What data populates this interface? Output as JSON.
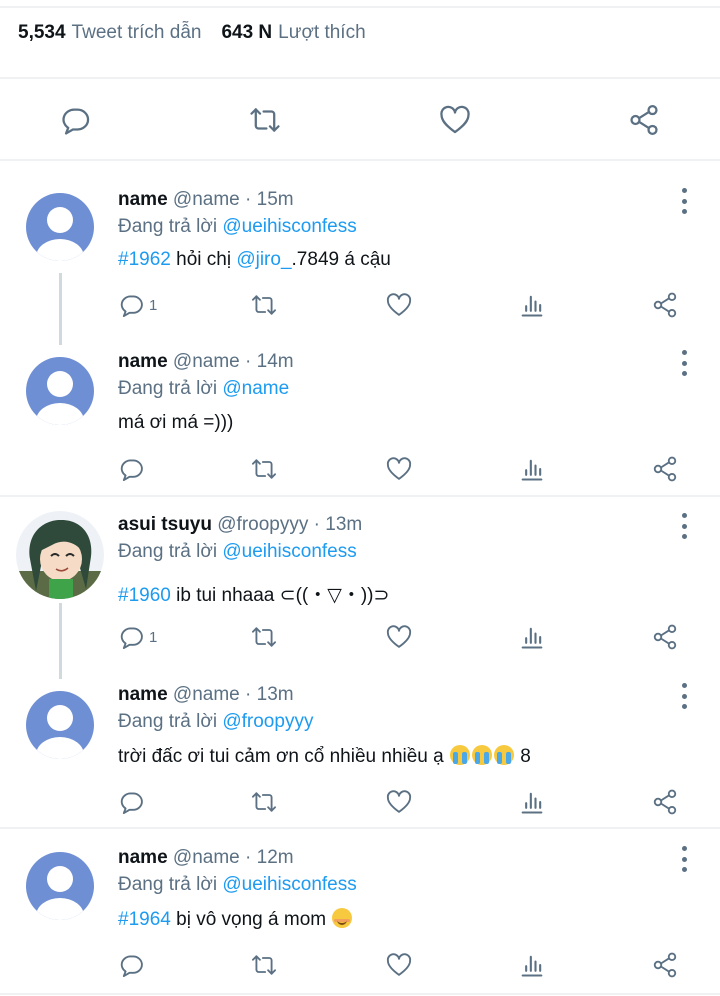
{
  "stats": {
    "quote_count": "5,534",
    "quote_label": "Tweet trích dẫn",
    "like_count": "643 N",
    "like_label": "Lượt thích"
  },
  "colors": {
    "link": "#1d9bf0",
    "secondary_text": "#5b7083",
    "primary_text": "#0f1419",
    "divider": "#eff1f3"
  },
  "replying_prefix": "Đang trả lời",
  "tweets": [
    {
      "name": "name",
      "handle": "@name",
      "time": "· 15m",
      "replying_to": "@ueihisconfess",
      "text_parts": {
        "tag": "#1962",
        "t1": " hỏi chị ",
        "mention": "@jiro_",
        "t2": ".7849 á cậu"
      },
      "reply_count": "1",
      "avatar_icon": "default-avatar-icon"
    },
    {
      "name": "name",
      "handle": "@name",
      "time": "· 14m",
      "replying_to": "@name",
      "text": "má ơi má =)))",
      "reply_count": "",
      "avatar_icon": "default-avatar-icon"
    },
    {
      "name": "asui tsuyu",
      "handle": "@froopyyy",
      "time": "· 13m",
      "replying_to": "@ueihisconfess",
      "text_parts": {
        "tag": "#1960",
        "t1": " ib tui nhaaa ⊂((・▽・))⊃"
      },
      "reply_count": "1",
      "avatar_icon": "anime-avatar-icon"
    },
    {
      "name": "name",
      "handle": "@name",
      "time": "· 13m",
      "replying_to": "@froopyyy",
      "text_parts": {
        "t1": "trời đấc ơi tui cảm ơn cổ nhiều nhiều ạ ",
        "t2": " 8"
      },
      "reply_count": "",
      "avatar_icon": "default-avatar-icon",
      "emoji": "loudly-crying-face-icon"
    },
    {
      "name": "name",
      "handle": "@name",
      "time": "· 12m",
      "replying_to": "@ueihisconfess",
      "text_parts": {
        "tag": "#1964",
        "t1": " bị vô vọng á mom "
      },
      "reply_count": "",
      "avatar_icon": "default-avatar-icon",
      "emoji": "smiling-face-icon"
    }
  ]
}
